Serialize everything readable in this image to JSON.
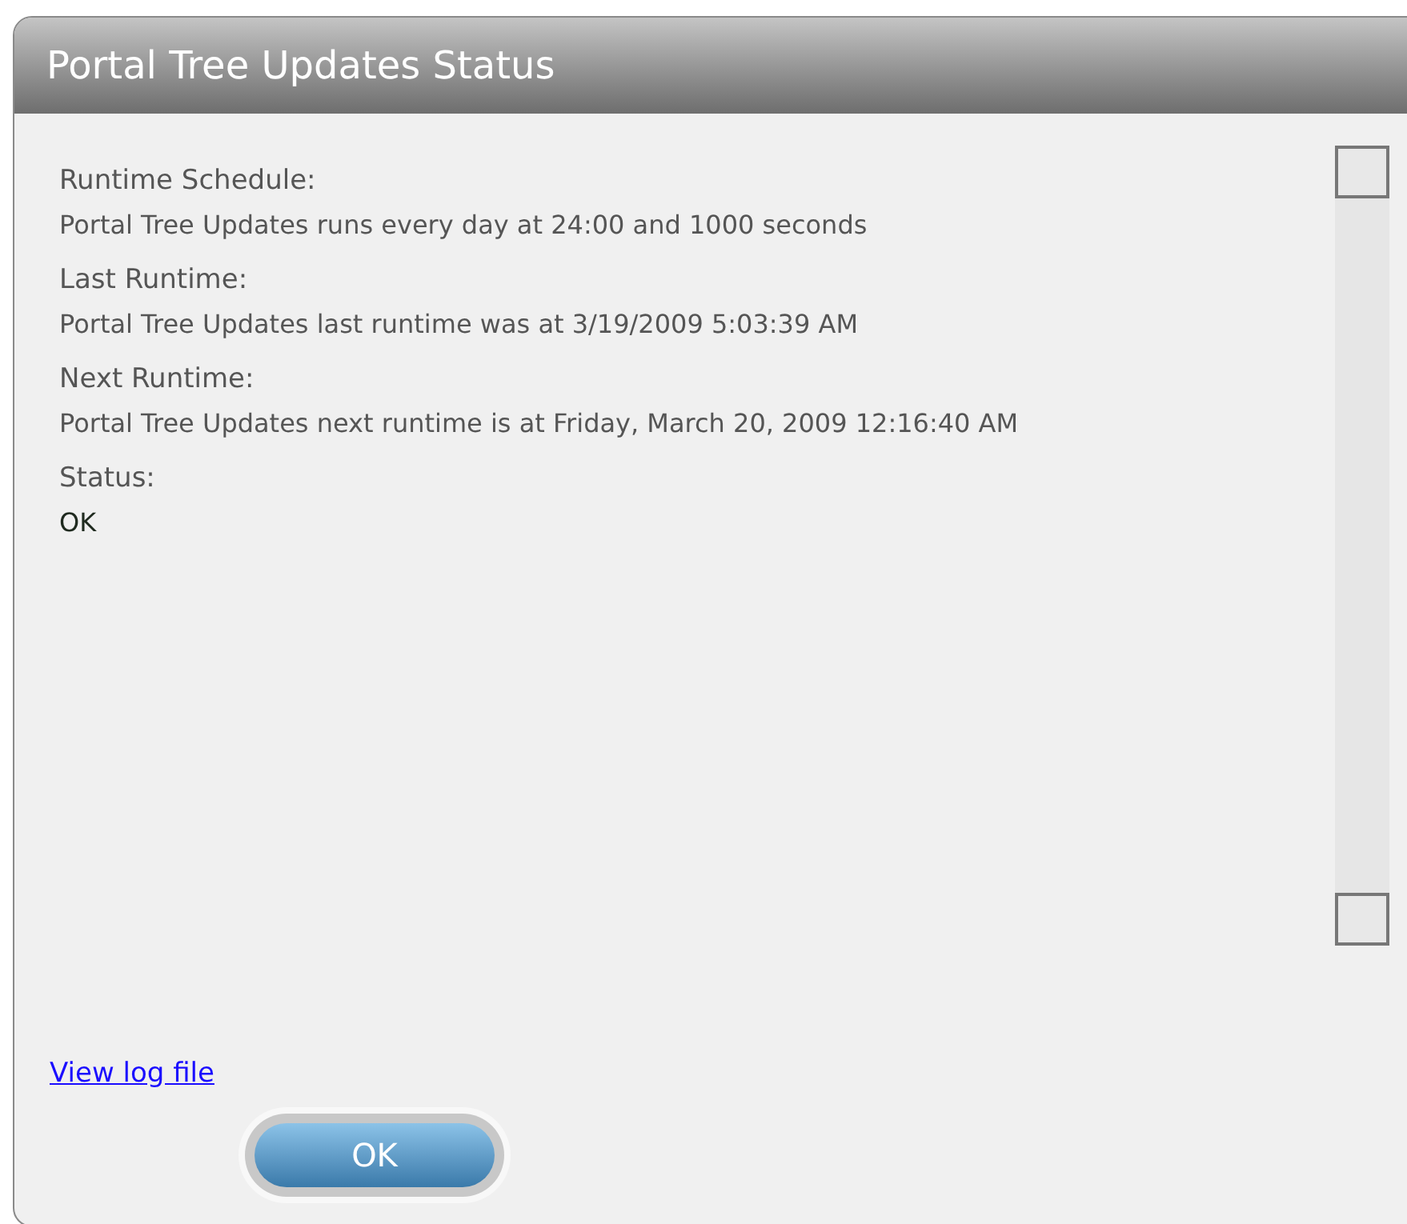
{
  "window": {
    "title": "Portal Tree Updates Status"
  },
  "sections": [
    {
      "label": "Runtime Schedule:",
      "value": "Portal Tree Updates runs every day at 24:00 and 1000 seconds",
      "kind": "info"
    },
    {
      "label": "Last Runtime:",
      "value": "Portal Tree Updates last runtime was at 3/19/2009 5:03:39 AM",
      "kind": "info"
    },
    {
      "label": "Next Runtime:",
      "value": "Portal Tree Updates next runtime is at Friday, March 20, 2009 12:16:40 AM",
      "kind": "info"
    },
    {
      "label": "Status:",
      "value": "OK",
      "kind": "status"
    }
  ],
  "link": "View log file",
  "buttons": [
    "OK"
  ]
}
